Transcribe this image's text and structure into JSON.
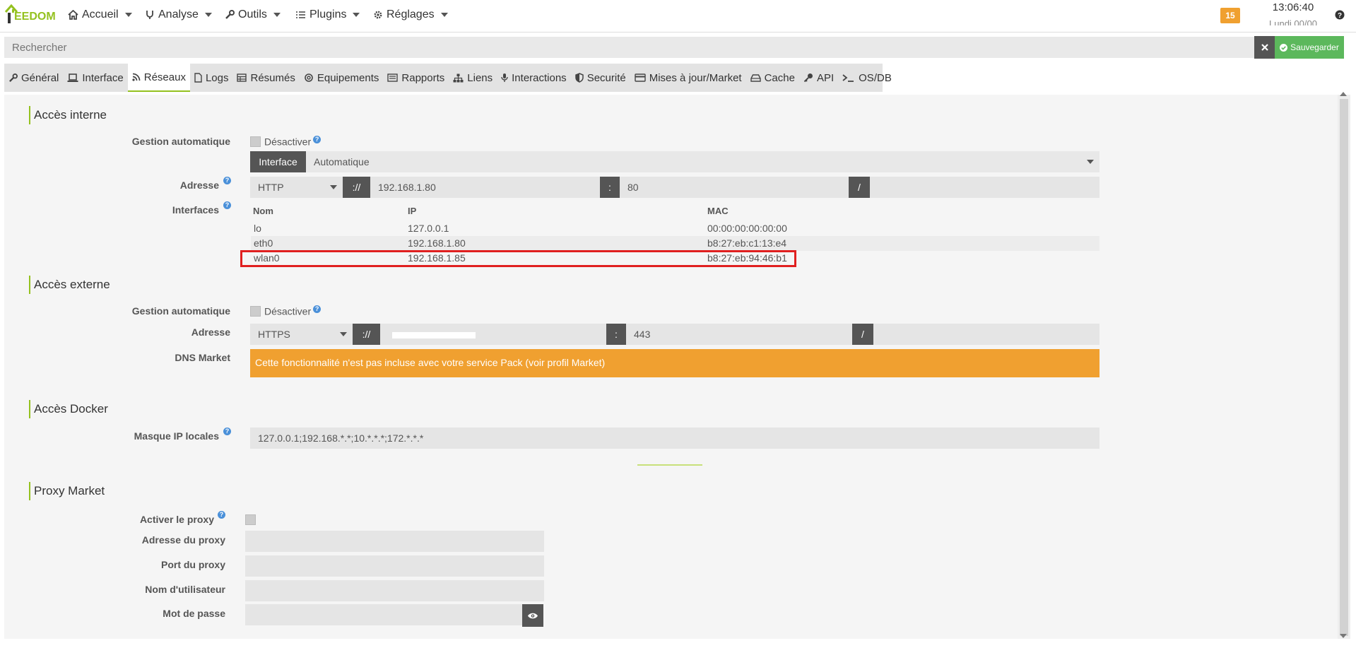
{
  "brand": {
    "logo_text": "EEDOM"
  },
  "nav": {
    "items": [
      {
        "label": "Accueil",
        "icon": "home-icon"
      },
      {
        "label": "Analyse",
        "icon": "stethoscope-icon"
      },
      {
        "label": "Outils",
        "icon": "wrench-icon"
      },
      {
        "label": "Plugins",
        "icon": "tasks-icon"
      },
      {
        "label": "Réglages",
        "icon": "gear-icon"
      }
    ],
    "badge": "15",
    "clock": "13:06:40",
    "clock_sub": "Lundi 00/00"
  },
  "search": {
    "placeholder": "Rechercher"
  },
  "toolbar": {
    "save_label": "Sauvegarder"
  },
  "tabs": [
    {
      "label": "Général",
      "icon": "wrench-icon"
    },
    {
      "label": "Interface",
      "icon": "laptop-icon"
    },
    {
      "label": "Réseaux",
      "icon": "rss-icon",
      "active": true
    },
    {
      "label": "Logs",
      "icon": "file-icon"
    },
    {
      "label": "Résumés",
      "icon": "table-icon"
    },
    {
      "label": "Equipements",
      "icon": "cogs-icon"
    },
    {
      "label": "Rapports",
      "icon": "newspaper-icon"
    },
    {
      "label": "Liens",
      "icon": "sitemap-icon"
    },
    {
      "label": "Interactions",
      "icon": "microphone-icon"
    },
    {
      "label": "Securité",
      "icon": "shield-icon"
    },
    {
      "label": "Mises à jour/Market",
      "icon": "credit-card-icon"
    },
    {
      "label": "Cache",
      "icon": "hdd-icon"
    },
    {
      "label": "API",
      "icon": "key-icon"
    },
    {
      "label": "OS/DB",
      "icon": "terminal-icon"
    }
  ],
  "internal": {
    "title": "Accès interne",
    "auto_label": "Gestion automatique",
    "disable_label": "Désactiver",
    "interface_btn": "Interface",
    "interface_value": "Automatique",
    "address_label": "Adresse",
    "protocol": "HTTP",
    "sep_proto": "://",
    "host": "192.168.1.80",
    "sep_port": ":",
    "port": "80",
    "sep_path": "/",
    "interfaces_label": "Interfaces",
    "columns": [
      "Nom",
      "IP",
      "MAC"
    ],
    "rows": [
      {
        "name": "lo",
        "ip": "127.0.0.1",
        "mac": "00:00:00:00:00:00"
      },
      {
        "name": "eth0",
        "ip": "192.168.1.80",
        "mac": "b8:27:eb:c1:13:e4"
      },
      {
        "name": "wlan0",
        "ip": "192.168.1.85",
        "mac": "b8:27:eb:94:46:b1"
      }
    ]
  },
  "external": {
    "title": "Accès externe",
    "auto_label": "Gestion automatique",
    "disable_label": "Désactiver",
    "address_label": "Adresse",
    "protocol": "HTTPS",
    "sep_proto": "://",
    "sep_port": ":",
    "port": "443",
    "sep_path": "/",
    "dns_label": "DNS Market",
    "dns_alert": "Cette fonctionnalité n'est pas incluse avec votre service Pack (voir profil Market)"
  },
  "docker": {
    "title": "Accès Docker",
    "mask_label": "Masque IP locales",
    "mask_value": "127.0.0.1;192.168.*.*;10.*.*.*;172.*.*.*"
  },
  "proxy": {
    "title": "Proxy Market",
    "enable_label": "Activer le proxy",
    "address_label": "Adresse du proxy",
    "port_label": "Port du proxy",
    "user_label": "Nom d'utilisateur",
    "password_label": "Mot de passe"
  },
  "colors": {
    "accent": "#94c11f",
    "save": "#5cb85c",
    "warning": "#f0a030",
    "highlight": "#e02020"
  }
}
